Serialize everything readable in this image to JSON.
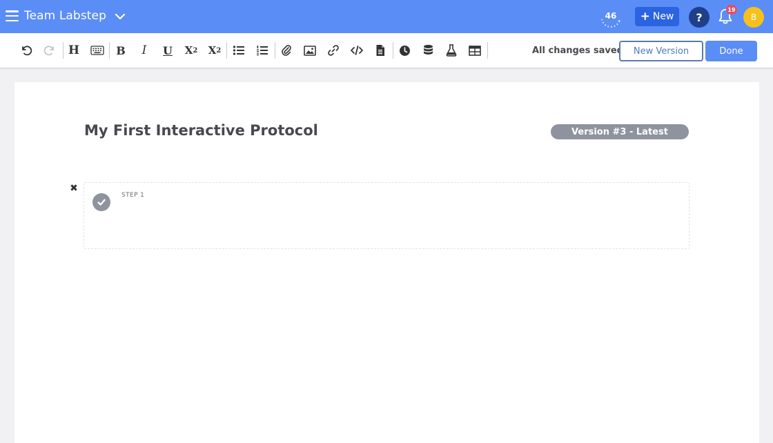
{
  "topbar": {
    "workspace_name": "Team Labstep",
    "counter": "46",
    "new_label": "New",
    "help_label": "?",
    "notifications_count": "19",
    "avatar_initial": "B",
    "icons": {
      "menu": "hamburger-icon",
      "workspace_dropdown": "chevron-down-icon",
      "notifications": "bell-icon"
    }
  },
  "toolbar": {
    "status": "All changes saved",
    "new_version_label": "New Version",
    "done_label": "Done",
    "tools": [
      "undo",
      "redo",
      "heading",
      "keyboard",
      "bold",
      "italic",
      "underline",
      "subscript",
      "superscript",
      "bullet-list",
      "numbered-list",
      "attachment",
      "image",
      "link",
      "code",
      "file",
      "timer",
      "database",
      "flask",
      "table"
    ]
  },
  "document": {
    "title": "My First Interactive Protocol",
    "version_label": "Version #3 - Latest",
    "steps": [
      {
        "label": "STEP 1"
      }
    ]
  },
  "colors": {
    "topbar": "#5b8df6",
    "primary_dark": "#2b63e0",
    "help": "#1e3f8a",
    "badge": "#e0506b",
    "avatar": "#f6c01d",
    "pill": "#8e939f"
  }
}
